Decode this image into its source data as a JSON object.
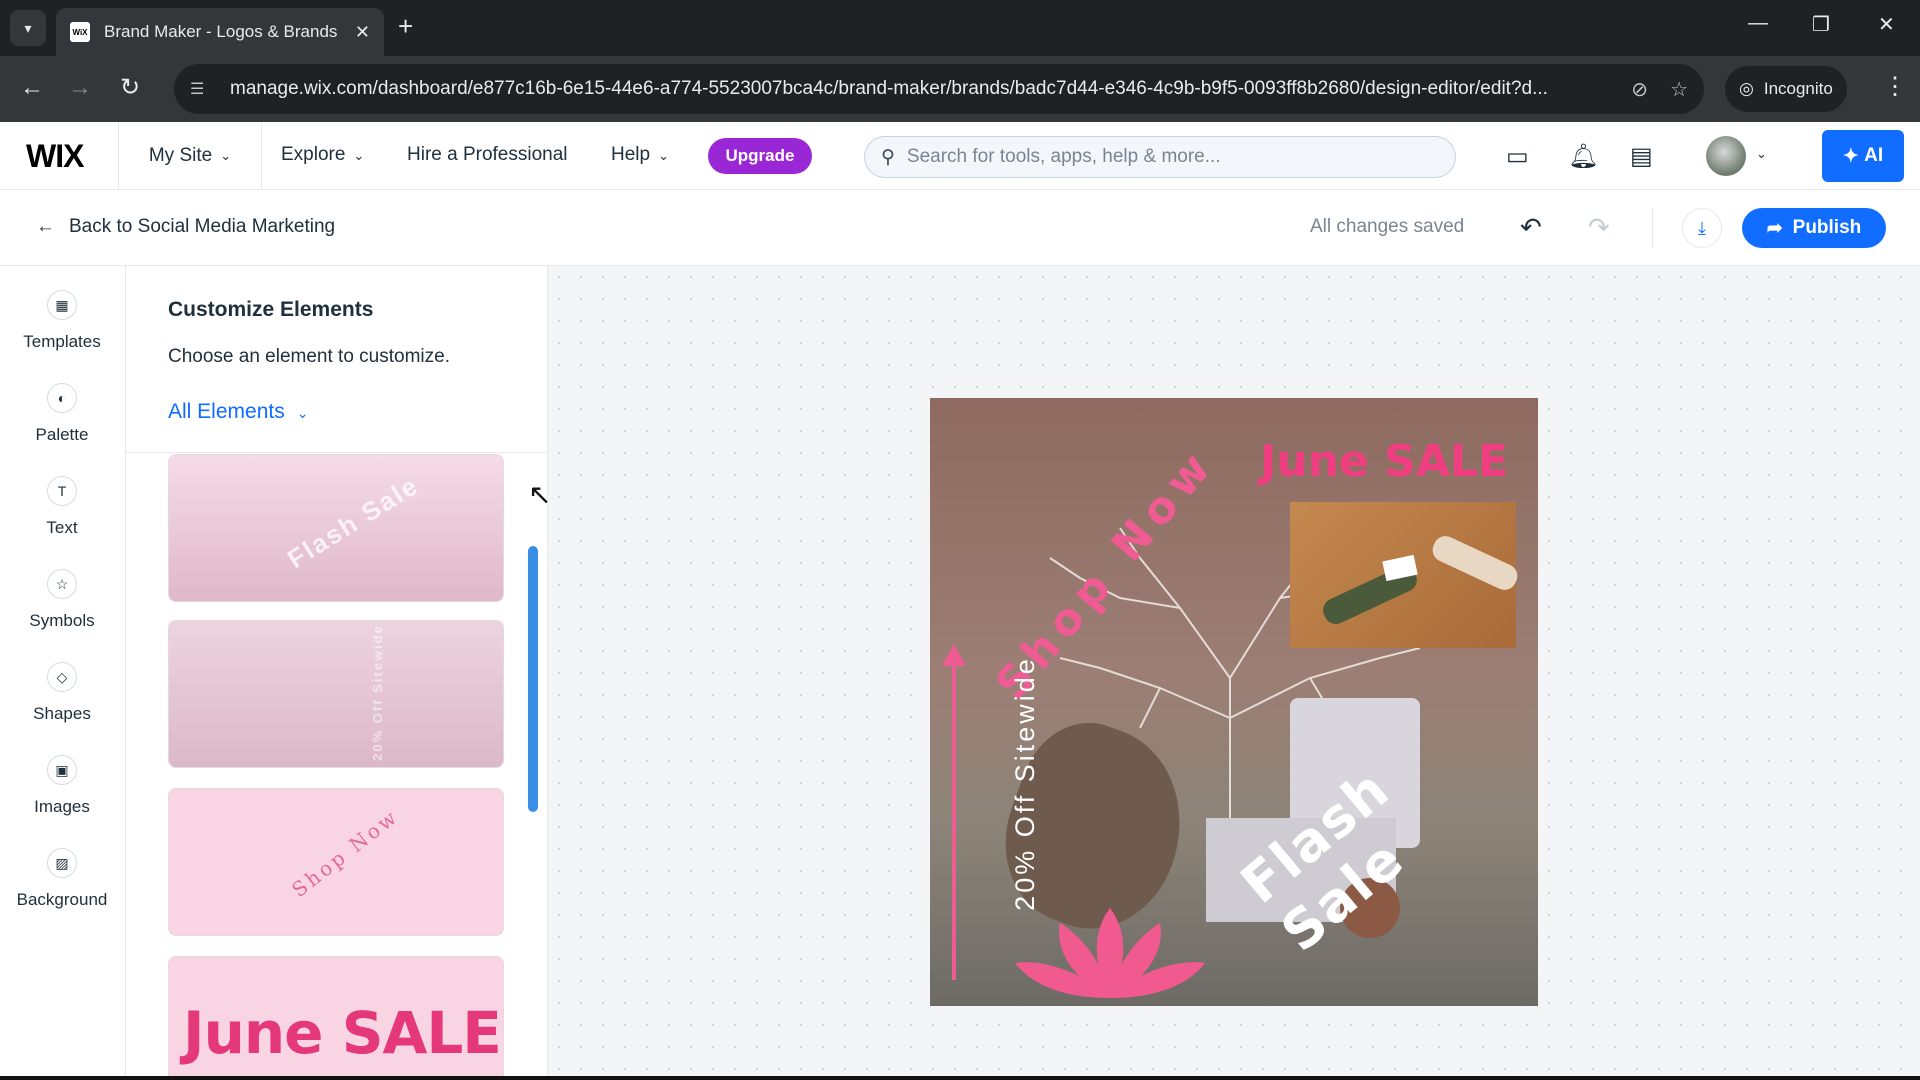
{
  "browser": {
    "tab_title": "Brand Maker - Logos & Brands",
    "favicon_text": "WiX",
    "url": "manage.wix.com/dashboard/e877c16b-6e15-44e6-a774-5523007bca4c/brand-maker/brands/badc7d44-e346-4c9b-b9f5-0093ff8b2680/design-editor/edit?d...",
    "incognito_label": "Incognito"
  },
  "header": {
    "logo": "WIX",
    "my_site": "My Site",
    "explore": "Explore",
    "hire": "Hire a Professional",
    "help": "Help",
    "upgrade": "Upgrade",
    "search_placeholder": "Search for tools, apps, help & more...",
    "ai_label": "AI"
  },
  "subbar": {
    "back_label": "Back to Social Media Marketing",
    "status": "All changes saved",
    "publish_label": "Publish"
  },
  "sidebar": {
    "items": [
      {
        "label": "Templates",
        "icon": "templates-icon"
      },
      {
        "label": "Palette",
        "icon": "palette-icon"
      },
      {
        "label": "Text",
        "icon": "text-icon"
      },
      {
        "label": "Symbols",
        "icon": "symbols-icon"
      },
      {
        "label": "Shapes",
        "icon": "shapes-icon"
      },
      {
        "label": "Images",
        "icon": "images-icon"
      },
      {
        "label": "Background",
        "icon": "background-icon"
      }
    ]
  },
  "panel": {
    "title": "Customize Elements",
    "subtitle": "Choose an element to customize.",
    "filter": "All Elements",
    "cards": [
      {
        "text": "Flash Sale"
      },
      {
        "text": "20% Off Sitewide"
      },
      {
        "text": "Shop Now"
      },
      {
        "text": "June SALE"
      }
    ]
  },
  "design": {
    "headline": "June SALE",
    "shop_now": "Shop Now",
    "discount": "20% Off Sitewide",
    "flash": "Flash Sale"
  },
  "colors": {
    "accent": "#116dff",
    "upgrade": "#9a27d5",
    "pink": "#f03f80"
  }
}
